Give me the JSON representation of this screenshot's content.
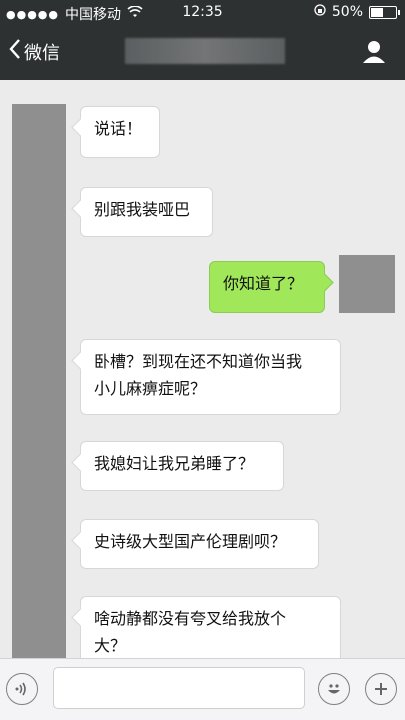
{
  "status": {
    "carrier": "中国移动",
    "time": "12:35",
    "battery": "50%"
  },
  "nav": {
    "back_label": "微信"
  },
  "messages": [
    {
      "side": "left",
      "text": "说话！"
    },
    {
      "side": "left",
      "text": "别跟我装哑巴"
    },
    {
      "side": "right",
      "text": "你知道了？"
    },
    {
      "side": "left",
      "text": "卧槽？到现在还不知道你当我\n小儿麻痹症呢？"
    },
    {
      "side": "left",
      "text": "我媳妇让我兄弟睡了？"
    },
    {
      "side": "left",
      "text": "史诗级大型国产伦理剧呗？"
    },
    {
      "side": "left",
      "text": "啥动静都没有夸叉给我放个\n大？"
    }
  ],
  "input": {
    "placeholder": ""
  },
  "icons": {
    "voice": "voice-icon",
    "emoji": "emoji-icon",
    "plus": "plus-icon",
    "profile": "profile-icon",
    "wifi": "wifi-icon",
    "battery": "battery-icon"
  },
  "colors": {
    "bar": "#2e3132",
    "chat_bg": "#ebebeb",
    "bubble_green": "#a0e75a"
  }
}
